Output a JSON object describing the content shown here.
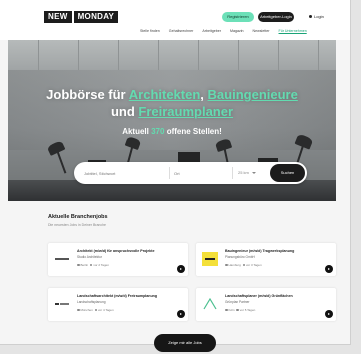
{
  "header": {
    "logo_part1": "NEW",
    "logo_part2": "MONDAY",
    "register_label": "Registrieren",
    "company_login_label": "Arbeitgeber-Login",
    "login_label": "Login",
    "nav": [
      "Stelle finden",
      "Gehaltsrechner",
      "Arbeitgeber",
      "Magazin",
      "Newsletter",
      "Für Unternehmen"
    ]
  },
  "hero": {
    "title_prefix": "Jobbörse für",
    "title_word1": "Architekten",
    "title_sep": ",",
    "title_word2": "Bauingenieure",
    "title_and": "und",
    "title_word3": "Freiraumplaner",
    "subtitle_prefix": "Aktuell",
    "count": "370",
    "subtitle_suffix": "offene Stellen!"
  },
  "search": {
    "keyword_placeholder": "Jobtitel, Stichwort",
    "location_placeholder": "Ort",
    "radius": "25 km",
    "button_label": "Suchen"
  },
  "jobs": {
    "title": "Aktuelle Branchenjobs",
    "subtitle": "Die neuesten Jobs in Deiner Branche",
    "cards": [
      {
        "title": "Architekt (m/w/d) für anspruchsvolle Projekte",
        "company": "Studio Architektur",
        "location": "Berlin",
        "date": "vor 2 Tagen",
        "logo_color": "#ffffff"
      },
      {
        "title": "Bauingenieur (m/w/d) Tragwerksplanung",
        "company": "Planungsbüro GmbH",
        "location": "Hamburg",
        "date": "vor 3 Tagen",
        "logo_color": "#f4e03a"
      },
      {
        "title": "Landschaftsarchitekt (m/w/d) Freiraumplanung",
        "company": "Landschaftsplanung",
        "location": "München",
        "date": "vor 4 Tagen",
        "logo_color": "#ffffff"
      },
      {
        "title": "Landschaftsplaner (m/w/d) Grünflächen",
        "company": "Grünplan Partner",
        "location": "Köln",
        "date": "vor 5 Tagen",
        "logo_color": "#ffffff"
      }
    ],
    "all_button_label": "Zeige mir alle Jobs"
  }
}
